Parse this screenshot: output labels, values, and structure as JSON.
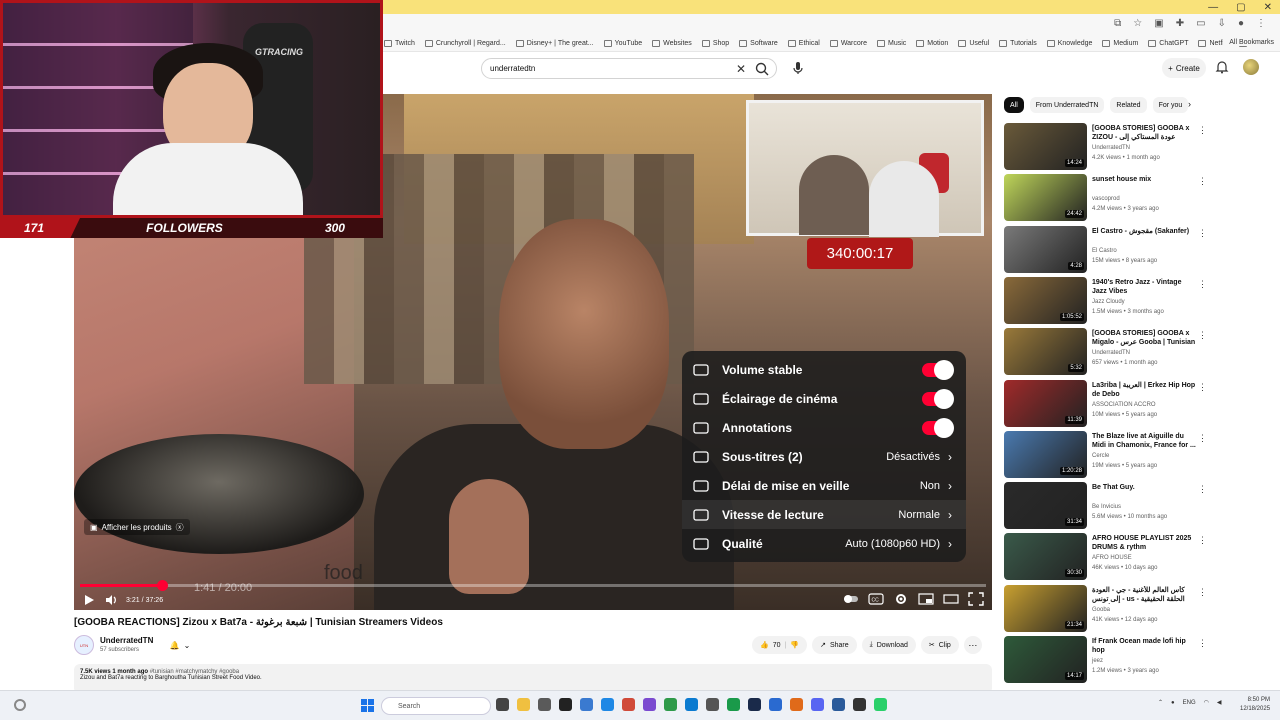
{
  "browser": {
    "bookmarks": [
      "Twitch",
      "Crunchyroll | Regard...",
      "Disney+ | The great...",
      "YouTube",
      "Websites",
      "Shop",
      "Software",
      "Ethical",
      "Warcore",
      "Music",
      "Motion",
      "Useful",
      "Tutorials",
      "Knowledge",
      "Medium",
      "ChatGPT",
      "Netflix",
      "EI"
    ],
    "all_bookmarks": "All Bookmarks"
  },
  "header": {
    "search_value": "underratedtn",
    "create_label": "Create"
  },
  "stream": {
    "followers_current": "171",
    "followers_label": "FOLLOWERS",
    "followers_goal": "300",
    "cam_brand": "GTRACING",
    "timer": "340:00:17",
    "inner_time": "1:41 / 20:00",
    "inner_caption": "food"
  },
  "player": {
    "current_time": "3:21",
    "duration": "37:26",
    "progress": 0.09,
    "show_products": "Afficher les produits",
    "settings": [
      {
        "label": "Volume stable",
        "type": "toggle",
        "on": true
      },
      {
        "label": "Éclairage de cinéma",
        "type": "toggle",
        "on": true
      },
      {
        "label": "Annotations",
        "type": "toggle",
        "on": true
      },
      {
        "label": "Sous-titres (2)",
        "type": "menu",
        "value": "Désactivés"
      },
      {
        "label": "Délai de mise en veille",
        "type": "menu",
        "value": "Non"
      },
      {
        "label": "Vitesse de lecture",
        "type": "menu",
        "value": "Normale"
      },
      {
        "label": "Qualité",
        "type": "menu",
        "value": "Auto (1080p60 HD)"
      }
    ]
  },
  "video": {
    "title": "[GOOBA REACTIONS] Zizou x Bat7a - شبعة برغوثة | Tunisian Streamers Videos",
    "channel": "UnderratedTN",
    "subscribers": "57 subscribers",
    "likes": "70",
    "share": "Share",
    "download": "Download",
    "clip": "Clip",
    "views_date": "7.5K views  1 month ago",
    "tags": "#tunisian #matchymatchy #gooba",
    "description": "Zizou and Bat7a reacting to Barghoutha Tunisian Street Food Video."
  },
  "sidebar": {
    "chips": [
      "All",
      "From UnderratedTN",
      "Related",
      "For you"
    ],
    "recommendations": [
      {
        "title": "[GOOBA STORIES] GOOBA x ZIZOU - عودة المستاكي إلى التيربي | ...",
        "channel": "UnderratedTN",
        "views": "4.2K views • 1 month ago",
        "duration": "14:24",
        "color": "#6a5a3a"
      },
      {
        "title": "sunset house mix",
        "channel": "vascoprod",
        "views": "4.2M views • 3 years ago",
        "duration": "24:42",
        "color": "#bfd65a"
      },
      {
        "title": "El Castro - مقجوش (Sakanfer)",
        "channel": "El Castro",
        "views": "15M views • 8 years ago",
        "duration": "4:28",
        "color": "#7a7a7a"
      },
      {
        "title": "1940's Retro Jazz - Vintage Jazz Vibes",
        "channel": "Jazz Cloudy",
        "views": "1.5M views • 3 months ago",
        "duration": "1:05:52",
        "color": "#8a6a3a"
      },
      {
        "title": "[GOOBA STORIES] GOOBA x Migalo - عرس Gooba | Tunisian ...",
        "channel": "UnderratedTN",
        "views": "657 views • 1 month ago",
        "duration": "5:32",
        "color": "#9a7a3a"
      },
      {
        "title": "La3riba | العريبة | Erkez Hip Hop de Debo",
        "channel": "ASSOCIATION ACCRO",
        "views": "10M views • 5 years ago",
        "duration": "11:39",
        "color": "#a02a2a"
      },
      {
        "title": "The Blaze live at Aiguille du Midi in Chamonix, France for ...",
        "channel": "Cercle",
        "views": "19M views • 5 years ago",
        "duration": "1:20:28",
        "color": "#4a7ab0"
      },
      {
        "title": "Be That Guy.",
        "channel": "Be Invicius",
        "views": "5.6M views • 10 months ago",
        "duration": "31:34",
        "color": "#2a2a2a"
      },
      {
        "title": "AFRO HOUSE PLAYLIST 2025 DRUMS & rythm",
        "channel": "AFRO HOUSE",
        "views": "46K views • 10 days ago",
        "duration": "30:30",
        "color": "#3a5a4a"
      },
      {
        "title": "كأس العالم للأغنية - جي - العودة إلى تونس - us - الحلقة الحقيقية لقذرة الأطعمة",
        "channel": "Gooba",
        "views": "41K views • 12 days ago",
        "duration": "21:34",
        "color": "#c9a030"
      },
      {
        "title": "If Frank Ocean made lofi hip hop",
        "channel": "jeez",
        "views": "1.2M views • 3 years ago",
        "duration": "14:17",
        "color": "#2e5a3a"
      }
    ]
  },
  "taskbar": {
    "search_placeholder": "Search",
    "lang": "ENG",
    "time": "8:50 PM",
    "date": "12/18/2025"
  }
}
